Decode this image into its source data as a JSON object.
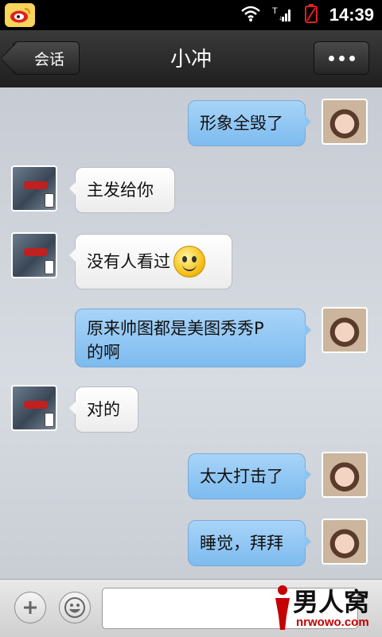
{
  "status_bar": {
    "time": "14:39",
    "icons": [
      "weibo-icon",
      "wifi-icon",
      "signal-icon",
      "battery-icon"
    ]
  },
  "header": {
    "back_label": "会话",
    "title": "小冲",
    "more_icon": "more-dots-icon"
  },
  "messages": [
    {
      "side": "right",
      "text": "形象全毁了"
    },
    {
      "side": "left",
      "text": "主发给你"
    },
    {
      "side": "left",
      "text": "没有人看过",
      "emoji": "smile-emoji-icon"
    },
    {
      "side": "right",
      "text": "原来帅图都是美图秀秀P的啊"
    },
    {
      "side": "left",
      "text": "对的"
    },
    {
      "side": "right",
      "text": "太大打击了"
    },
    {
      "side": "right",
      "text": "睡觉，拜拜"
    }
  ],
  "bottom_bar": {
    "add_icon": "plus-icon",
    "emoji_icon": "emoji-icon",
    "input_value": ""
  },
  "watermark": {
    "text": "男人窝",
    "url": "nrwowo.com"
  },
  "colors": {
    "sent_bubble": "#8cc4f2",
    "received_bubble": "#f8f8f8",
    "header_bg": "#2a2a2a",
    "chat_bg": "#d0d4db",
    "watermark_accent": "#c40000"
  }
}
